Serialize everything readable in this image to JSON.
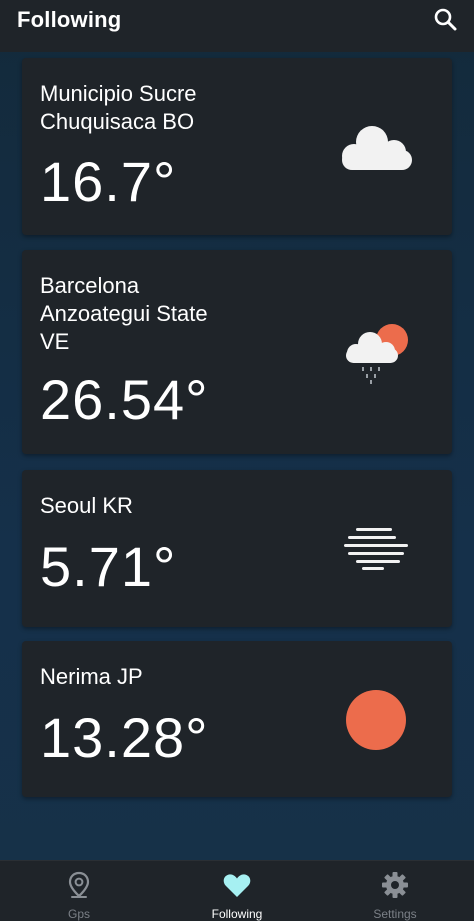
{
  "header": {
    "title": "Following",
    "search_icon": "search-icon"
  },
  "cards": [
    {
      "name": "Municipio Sucre\nChuquisaca BO",
      "temp": "16.7°",
      "icon": "cloud-icon"
    },
    {
      "name": "Barcelona\nAnzoategui State\nVE",
      "temp": "26.54°",
      "icon": "rain-cloud-sun-icon"
    },
    {
      "name": "Seoul KR",
      "temp": "5.71°",
      "icon": "fog-icon"
    },
    {
      "name": "Nerima JP",
      "temp": "13.28°",
      "icon": "sun-icon"
    }
  ],
  "nav": {
    "items": [
      {
        "label": "Gps",
        "icon": "location-pin-icon",
        "active": false
      },
      {
        "label": "Following",
        "icon": "heart-icon",
        "active": true
      },
      {
        "label": "Settings",
        "icon": "gear-icon",
        "active": false
      }
    ]
  },
  "colors": {
    "background": "#15293a",
    "surface": "#1f2429",
    "text": "#ffffff",
    "muted": "#7b8087",
    "accent": "#a6f0f2",
    "sun": "#ec6c4c",
    "cloud": "#f2f2f2"
  }
}
